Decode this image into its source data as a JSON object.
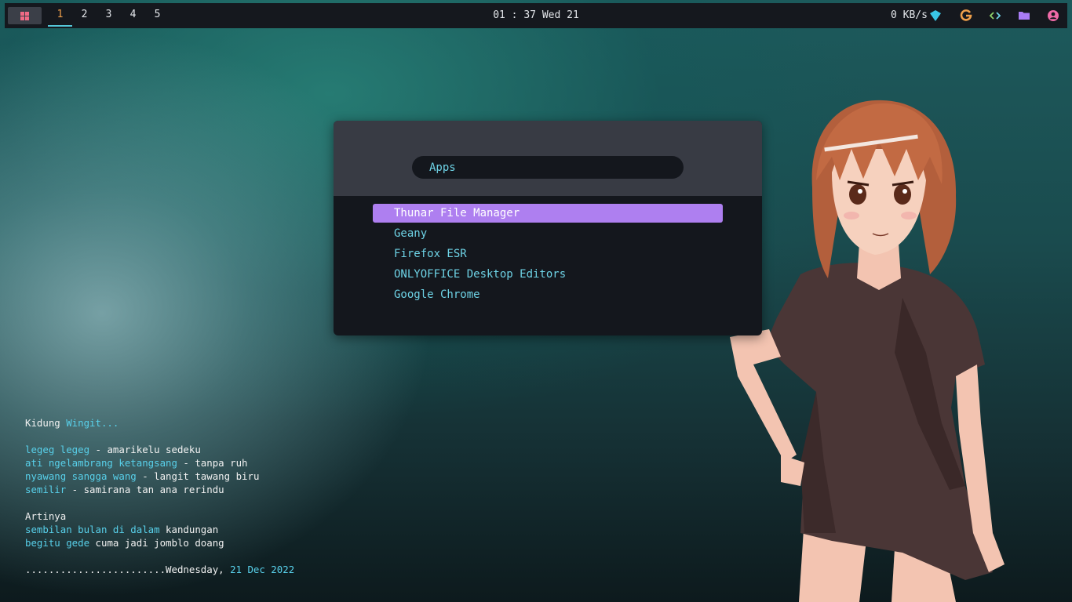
{
  "colors": {
    "accent_cyan": "#6ed3e6",
    "selection_purple": "#ae7ff0",
    "active_workspace": "#f0a04b",
    "bar_bg": "#15181e"
  },
  "topbar": {
    "start_icon": "windows-logo-icon",
    "workspaces": [
      "1",
      "2",
      "3",
      "4",
      "5"
    ],
    "active_workspace": "1",
    "clock": "01 : 37 Wed 21",
    "netspeed": "0 KB/s",
    "tray_icons": [
      "wifi-icon",
      "google-icon",
      "code-icon",
      "folder-icon",
      "user-icon"
    ]
  },
  "launcher": {
    "prompt": "Apps",
    "items": [
      "Thunar File Manager",
      "Geany",
      "Firefox ESR",
      "ONLYOFFICE Desktop Editors",
      "Google Chrome"
    ],
    "selected": "Thunar File Manager"
  },
  "conky": {
    "title_a": "Kidung ",
    "title_b": "Wingit...",
    "lines": [
      {
        "a": "legeg legeg",
        "b": " - amarikelu sedeku"
      },
      {
        "a": "ati ngelambrang ketangsang",
        "b": " - tanpa ruh"
      },
      {
        "a": "nyawang sangga wang",
        "b": " - langit tawang biru"
      },
      {
        "a": "semilir",
        "b": " - samirana tan ana rerindu"
      }
    ],
    "artinya": "Artinya",
    "meaning": [
      {
        "a": "sembilan bulan di dalam",
        "b": " kandungan"
      },
      {
        "a": "begitu gede",
        "b": " cuma jadi jomblo doang"
      }
    ],
    "date_prefix": "........................Wednesday, ",
    "date": "21 Dec 2022"
  }
}
